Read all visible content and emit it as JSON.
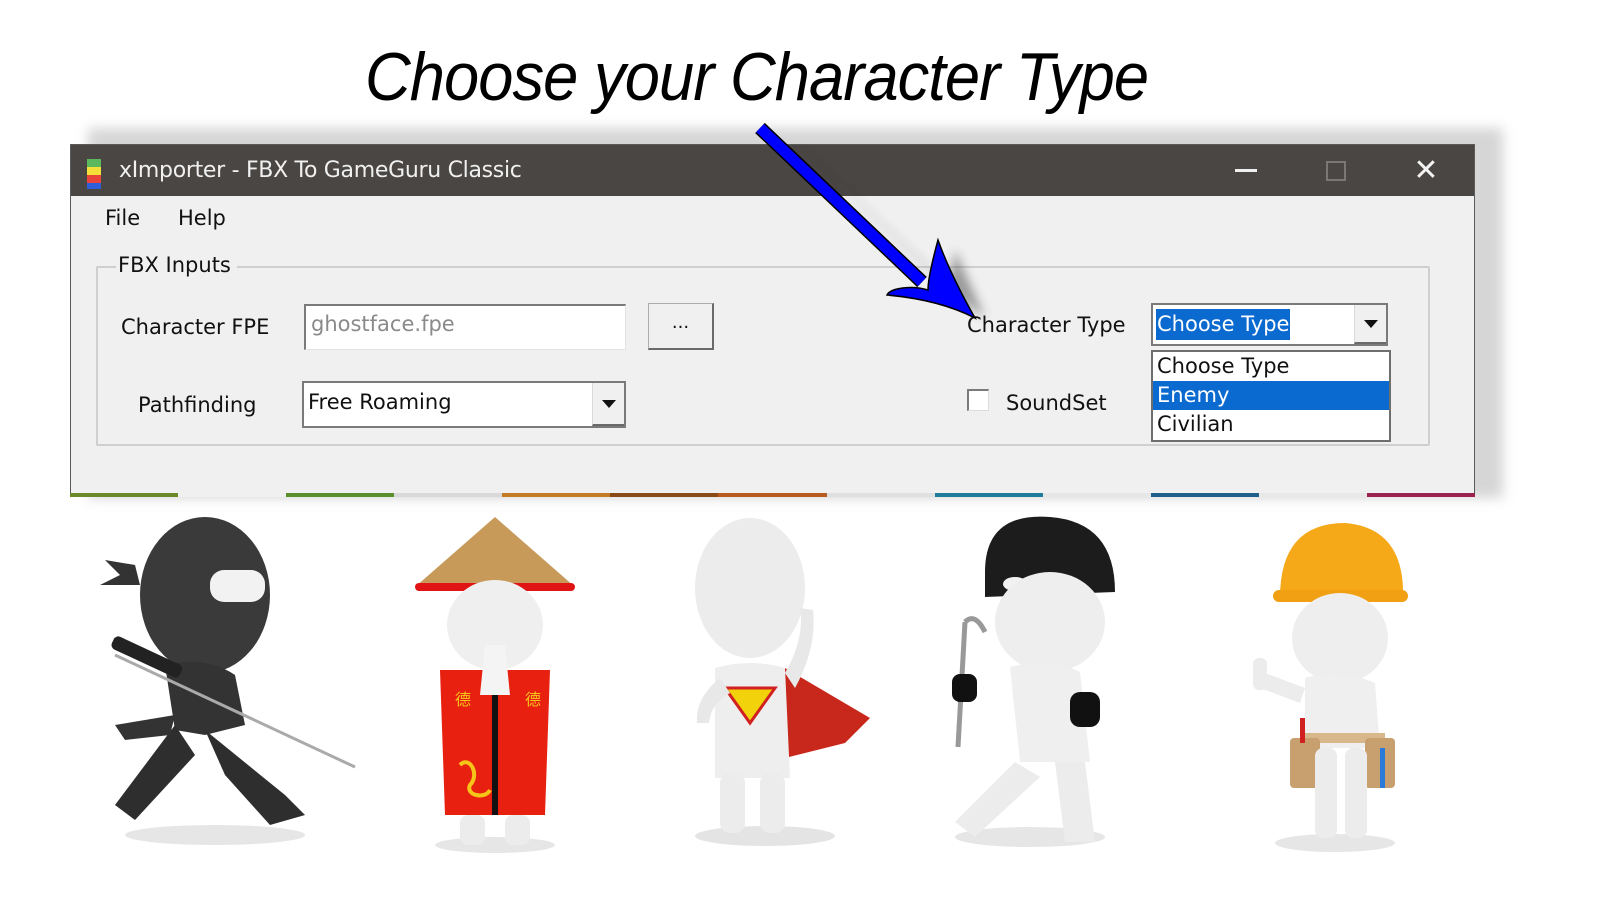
{
  "headline": "Choose your Character Type",
  "window": {
    "title": "xImporter - FBX To GameGuru Classic",
    "controls": {
      "minimize": "minimize",
      "maximize": "maximize",
      "close": "✕"
    }
  },
  "menu": [
    {
      "label": "File"
    },
    {
      "label": "Help"
    }
  ],
  "fbx_inputs": {
    "group_label": "FBX Inputs",
    "character_fpe": {
      "label": "Character FPE",
      "value": "ghostface.fpe",
      "browse_label": "..."
    },
    "pathfinding": {
      "label": "Pathfinding",
      "value": "Free Roaming"
    },
    "character_type": {
      "label": "Character Type",
      "value": "Choose Type",
      "options": [
        "Choose Type",
        "Enemy",
        "Civilian"
      ],
      "highlighted": "Enemy"
    },
    "soundset": {
      "label": "SoundSet",
      "checked": false
    }
  },
  "colors": {
    "titlebar": "#494643",
    "selection": "#0a6ad0",
    "arrow": "#0000ff"
  },
  "characters": [
    {
      "name": "ninja"
    },
    {
      "name": "chinese-robe"
    },
    {
      "name": "superhero"
    },
    {
      "name": "burglar"
    },
    {
      "name": "construction-worker"
    }
  ]
}
